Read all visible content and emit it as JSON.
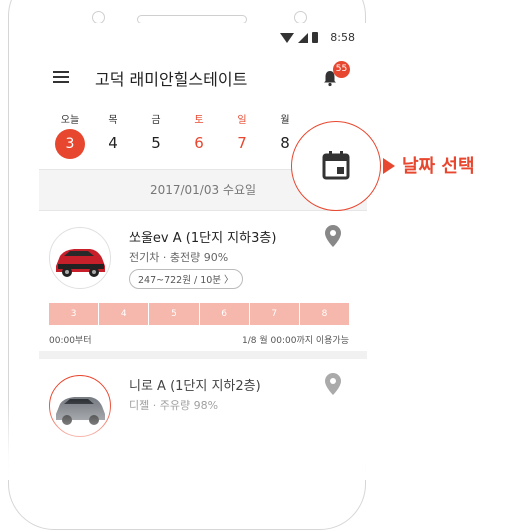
{
  "status_bar": {
    "time": "8:58"
  },
  "app_bar": {
    "title": "고덕 래미안힐스테이트",
    "notification_count": "55"
  },
  "calendar": {
    "days": [
      {
        "name": "오늘",
        "num": "3"
      },
      {
        "name": "목",
        "num": "4"
      },
      {
        "name": "금",
        "num": "5"
      },
      {
        "name": "토",
        "num": "6"
      },
      {
        "name": "일",
        "num": "7"
      },
      {
        "name": "월",
        "num": "8"
      }
    ]
  },
  "date_banner": "2017/01/03 수요일",
  "cars": [
    {
      "name": "쏘울ev A (1단지 지하3층)",
      "info": "전기차 · 충전량 90%",
      "price": "247~722원 / 10분 〉",
      "slots": [
        "3",
        "4",
        "5",
        "6",
        "7",
        "8"
      ],
      "range_start": "00:00부터",
      "range_end": "1/8 월 00:00까지 이용가능"
    },
    {
      "name": "니로 A (1단지 지하2층)",
      "info": "디젤 · 주유량 98%"
    }
  ],
  "callout": {
    "label": "날짜 선택"
  },
  "colors": {
    "accent": "#e8472f",
    "slot": "#f6b7ac"
  }
}
